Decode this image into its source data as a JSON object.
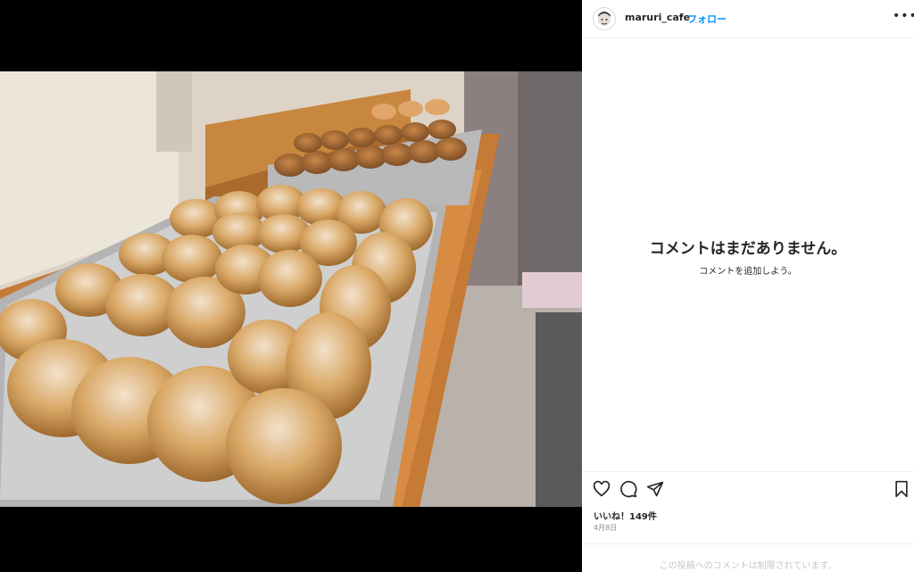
{
  "post": {
    "username": "maruri_cafe",
    "separator": "•",
    "follow_label": "フォロー",
    "more_label": "•••",
    "image_alt_name": "pastry-photo"
  },
  "comments": {
    "empty_title": "コメントはまだありません。",
    "empty_subtitle": "コメントを追加しよう。"
  },
  "footer": {
    "likes_text": "いいね！149件",
    "date_text": "4月8日",
    "restricted_text": "この投稿へのコメントは制限されています。"
  },
  "icons": [
    "heart-icon",
    "comment-icon",
    "share-icon",
    "bookmark-icon"
  ],
  "colors": {
    "follow": "#0095f6",
    "text": "#262626",
    "muted": "#8e8e8e"
  }
}
